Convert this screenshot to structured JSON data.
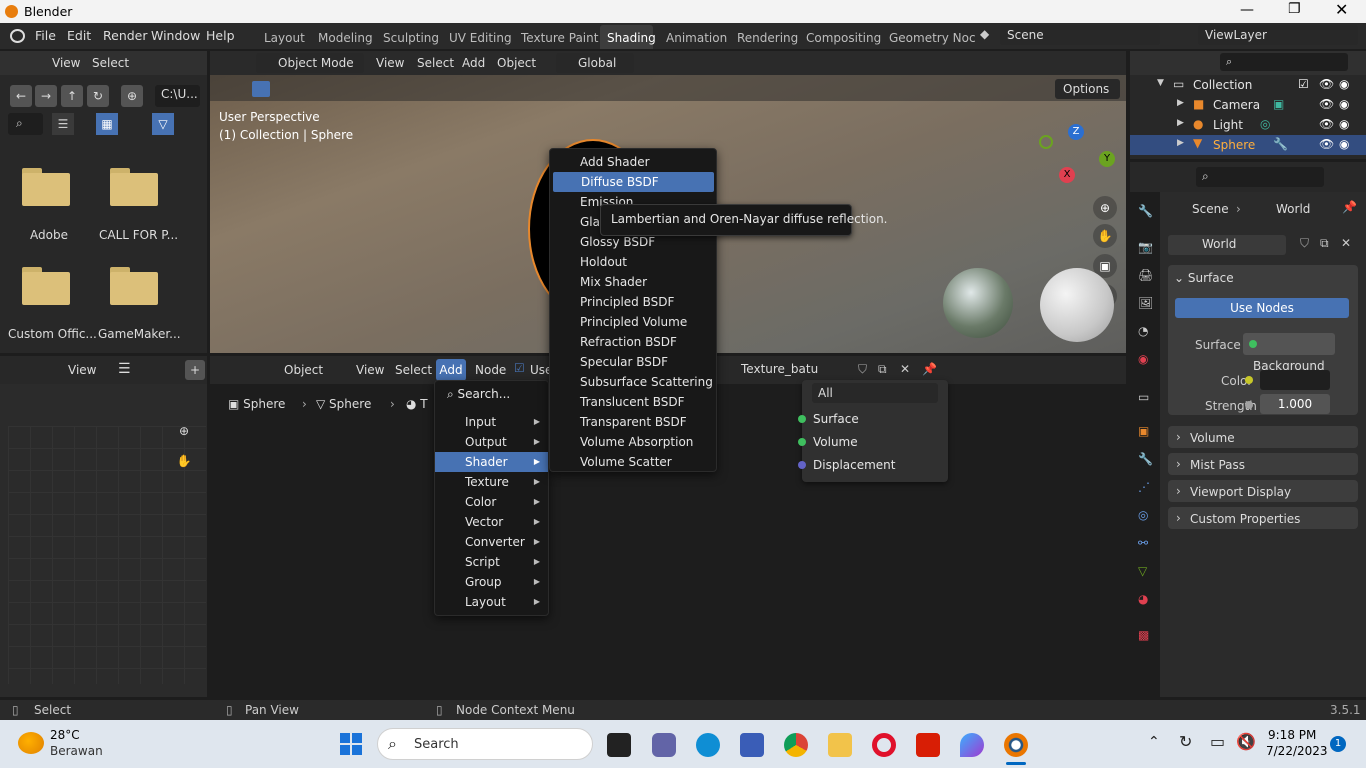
{
  "window": {
    "title": "Blender"
  },
  "menu": {
    "file": "File",
    "edit": "Edit",
    "render": "Render",
    "window": "Window",
    "help": "Help"
  },
  "workspaces": [
    "Layout",
    "Modeling",
    "Sculpting",
    "UV Editing",
    "Texture Paint",
    "Shading",
    "Animation",
    "Rendering",
    "Compositing",
    "Geometry Noc"
  ],
  "scene": {
    "name": "Scene",
    "view_layer": "ViewLayer"
  },
  "file_browser": {
    "view": "View",
    "select": "Select",
    "path": "C:\\U...",
    "folders": [
      "Adobe",
      "CALL FOR P...",
      "Custom Offic...",
      "GameMaker..."
    ]
  },
  "viewport": {
    "mode": "Object Mode",
    "view": "View",
    "select": "Select",
    "add": "Add",
    "object": "Object",
    "orientation": "Global",
    "options": "Options",
    "perspective": "User Perspective",
    "collection_info": "(1) Collection | Sphere"
  },
  "outliner": {
    "items": [
      "Collection",
      "Camera",
      "Light",
      "Sphere"
    ]
  },
  "properties": {
    "scene": "Scene",
    "world": "World",
    "world_name": "World",
    "surface_panel": "Surface",
    "use_nodes": "Use Nodes",
    "surface_label": "Surface",
    "surface_value": "Background",
    "color_label": "Color",
    "strength_label": "Strength",
    "strength_value": "1.000",
    "panels": [
      "Volume",
      "Mist Pass",
      "Viewport Display",
      "Custom Properties"
    ]
  },
  "image_editor": {
    "view": "View"
  },
  "node_editor": {
    "type": "Object",
    "view": "View",
    "select": "Select",
    "add": "Add",
    "node": "Node",
    "use_nodes": "Use",
    "material": "Texture_batu",
    "breadcrumb": [
      "Sphere",
      "Sphere",
      "T"
    ],
    "output_target": "All",
    "output_sockets": [
      "Surface",
      "Volume",
      "Displacement"
    ]
  },
  "add_menu": {
    "search": "Search...",
    "items": [
      "Input",
      "Output",
      "Shader",
      "Texture",
      "Color",
      "Vector",
      "Converter",
      "Script",
      "Group",
      "Layout"
    ],
    "highlighted": "Shader"
  },
  "shader_menu": {
    "items": [
      "Add Shader",
      "Diffuse BSDF",
      "Emission",
      "Gla",
      "Glossy BSDF",
      "Holdout",
      "Mix Shader",
      "Principled BSDF",
      "Principled Volume",
      "Refraction BSDF",
      "Specular BSDF",
      "Subsurface Scattering",
      "Translucent BSDF",
      "Transparent BSDF",
      "Volume Absorption",
      "Volume Scatter"
    ],
    "highlighted": "Diffuse BSDF",
    "tooltip": "Lambertian and Oren-Nayar diffuse reflection."
  },
  "statusbar": {
    "select": "Select",
    "pan": "Pan View",
    "context": "Node Context Menu",
    "version": "3.5.1"
  },
  "taskbar": {
    "temperature": "28°C",
    "weather": "Berawan",
    "search": "Search",
    "time": "9:18 PM",
    "date": "7/22/2023",
    "notifications": "1"
  },
  "colors": {
    "accent": "#4772b3",
    "orange": "#e8882c",
    "folder": "#dcc07a"
  }
}
